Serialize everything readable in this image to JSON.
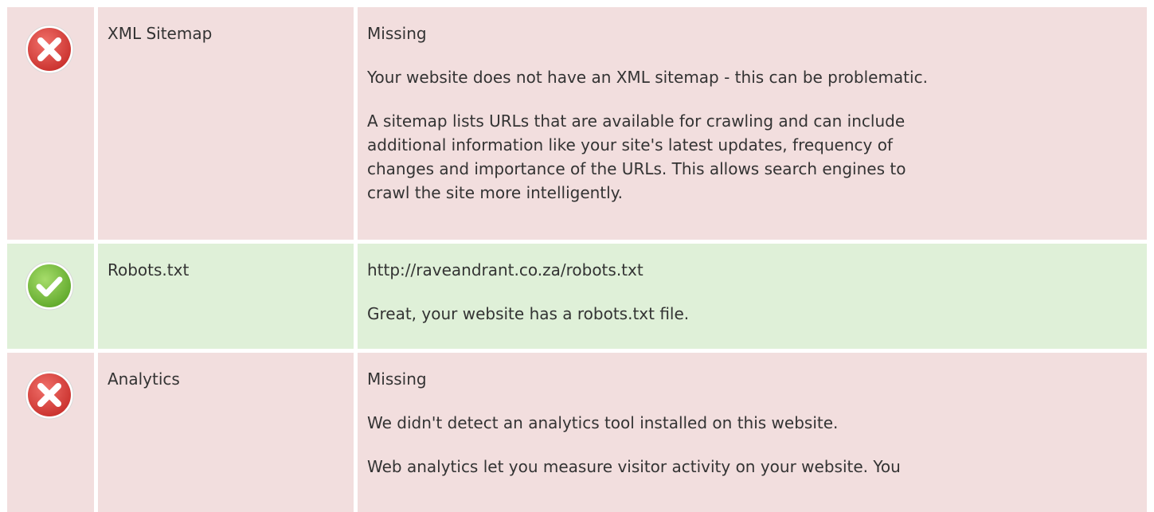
{
  "rows": [
    {
      "status": "fail",
      "icon": "error-icon",
      "name": "XML Sitemap",
      "value": "Missing",
      "message": "Your website does not have an XML sitemap - this can be problematic.",
      "description_lines": [
        "A sitemap lists URLs that are available for crawling and can include",
        "additional information like your site's latest updates, frequency of",
        "changes and importance of the URLs. This allows search engines to",
        "crawl the site more intelligently."
      ]
    },
    {
      "status": "pass",
      "icon": "success-icon",
      "name": "Robots.txt",
      "value": "http://raveandrant.co.za/robots.txt",
      "message": "Great, your website has a robots.txt file."
    },
    {
      "status": "fail",
      "icon": "error-icon",
      "name": "Analytics",
      "value": "Missing",
      "message": "We didn't detect an analytics tool installed on this website.",
      "description_lines": [
        "Web analytics let you measure visitor activity on your website. You"
      ]
    }
  ],
  "colors": {
    "fail_bg": "#f2dede",
    "pass_bg": "#dff0d8",
    "fail_icon": "#d9534f",
    "pass_icon": "#7cc23f",
    "text": "#333333"
  }
}
